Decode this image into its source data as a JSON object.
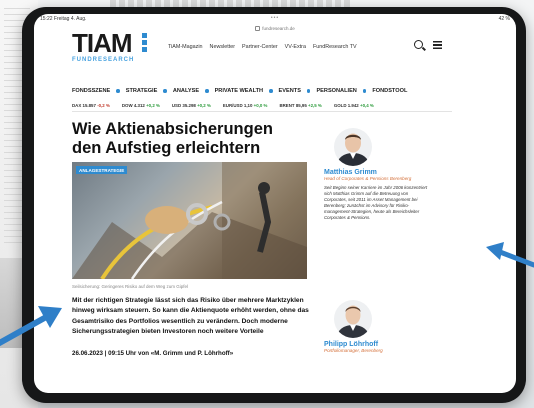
{
  "statusbar": {
    "time": "15:22  Freitag 4. Aug.",
    "battery": "42 %",
    "dots": "•••"
  },
  "browser": {
    "url": "fundresearch.de"
  },
  "site": {
    "logo_word": "TIAM",
    "logo_sub": "FUNDRESEARCH",
    "nav": [
      "TiAM-Magazin",
      "Newsletter",
      "Partner-Center",
      "VV-Extra",
      "FundResearch TV"
    ],
    "categories": [
      "FONDSSZENE",
      "STRATEGIE",
      "ANALYSE",
      "PRIVATE WEALTH",
      "EVENTS",
      "PERSONALIEN",
      "FONDSTOOL"
    ]
  },
  "ticker": [
    {
      "name": "DAX",
      "value": "15.857",
      "change": "-0,2 %",
      "trend": "neg"
    },
    {
      "name": "DOW",
      "value": "4.312",
      "change": "+0,2 %",
      "trend": "pos"
    },
    {
      "name": "USD",
      "value": "35.298",
      "change": "+0,2 %",
      "trend": "pos"
    },
    {
      "name": "EUR/USD",
      "value": "1,10",
      "change": "+0,0 %",
      "trend": "pos"
    },
    {
      "name": "BRENT",
      "value": "85,95",
      "change": "+2,5 %",
      "trend": "pos"
    },
    {
      "name": "GOLD",
      "value": "1.942",
      "change": "+0,4 %",
      "trend": "pos"
    }
  ],
  "article": {
    "title": "Wie Aktienabsicherungen den Aufstieg erleichtern",
    "tag": "ANLAGESTRATEGIE",
    "caption": "Seilsicherung: Geringeres Risiko auf dem Weg zum Gipfel",
    "teaser": "Mit der richtigen Strategie lässt sich das Risiko über mehrere Marktzyklen hinweg wirksam steuern. So kann die Aktienquote erhöht werden, ohne das Gesamtrisiko des Portfolios wesentlich zu verändern. Doch moderne Sicherungsstrategien bieten Investoren noch weitere Vorteile",
    "dateline": "26.06.2023 | 09:15 Uhr von «M. Grimm und P. Löhrhoff»"
  },
  "authors": [
    {
      "name": "Matthias Grimm",
      "role": "Head of Corporates & Pensions Berenberg",
      "bio": "Seit Beginn seiner Karriere im Jahr 2006 konzentriert sich Matthias Grimm auf die Betreuung von Corporates, seit 2011 im Asset Management bei Berenberg; zunächst im Advisory für Risiko-management-Strategien, heute als Bereichsleiter Corporates & Pensions."
    },
    {
      "name": "Philipp Löhrhoff",
      "role": "Portfoliomanager, Berenberg",
      "bio": ""
    }
  ],
  "colors": {
    "accent": "#2e8bd0",
    "arrow": "#2f7fc8",
    "frame": "#161718"
  }
}
